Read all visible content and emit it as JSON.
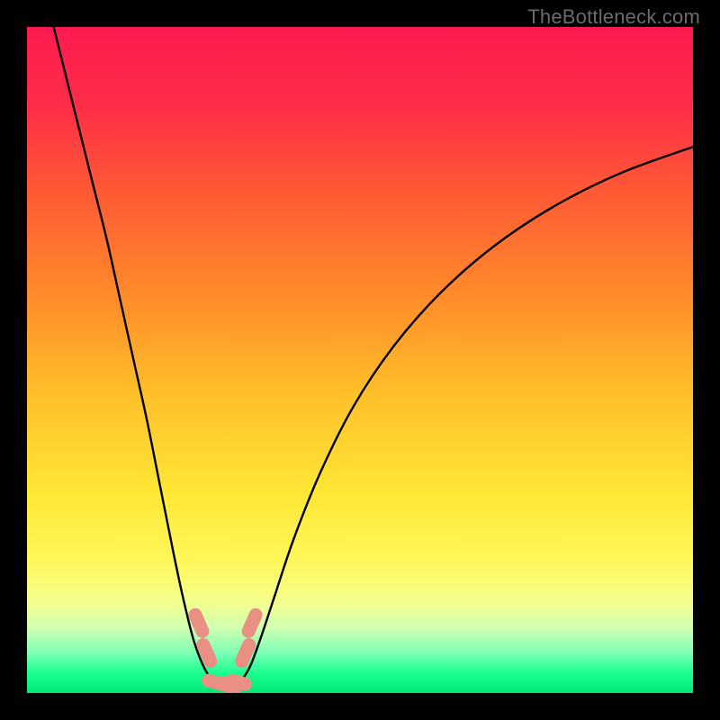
{
  "watermark": "TheBottleneck.com",
  "chart_data": {
    "type": "line",
    "title": "",
    "xlabel": "",
    "ylabel": "",
    "xlim": [
      0,
      100
    ],
    "ylim": [
      0,
      100
    ],
    "grid": false,
    "legend": false,
    "background_gradient": {
      "stops": [
        {
          "pct": 0,
          "color": "#ff1a51"
        },
        {
          "pct": 12,
          "color": "#ff2e47"
        },
        {
          "pct": 25,
          "color": "#ff5a35"
        },
        {
          "pct": 40,
          "color": "#ff8a2a"
        },
        {
          "pct": 55,
          "color": "#ffbf2a"
        },
        {
          "pct": 70,
          "color": "#ffe735"
        },
        {
          "pct": 80,
          "color": "#fff75a"
        },
        {
          "pct": 86,
          "color": "#f6ff8a"
        },
        {
          "pct": 90,
          "color": "#d4ffb0"
        },
        {
          "pct": 94,
          "color": "#7dffb5"
        },
        {
          "pct": 97,
          "color": "#1aff8f"
        },
        {
          "pct": 100,
          "color": "#00e874"
        }
      ]
    },
    "series": [
      {
        "name": "left-branch",
        "color": "#000000",
        "x": [
          4,
          6,
          8,
          10,
          12,
          14,
          16,
          18,
          20,
          22,
          23.5,
          25,
          26.5,
          28
        ],
        "y": [
          100,
          92,
          84,
          76,
          68,
          59,
          50,
          41,
          31,
          21,
          14,
          8,
          4,
          1.5
        ]
      },
      {
        "name": "right-branch",
        "color": "#000000",
        "x": [
          32,
          33.5,
          35,
          37,
          40,
          44,
          49,
          55,
          62,
          70,
          79,
          89,
          100
        ],
        "y": [
          1.5,
          4,
          8,
          14,
          23,
          33,
          43,
          52,
          60,
          67,
          73,
          78,
          82
        ]
      },
      {
        "name": "valley-floor",
        "color": "#000000",
        "x": [
          28,
          29,
          30,
          31,
          32
        ],
        "y": [
          1.5,
          1.2,
          1.1,
          1.2,
          1.5
        ]
      }
    ],
    "markers": [
      {
        "name": "left-marker-upper",
        "x": 25.8,
        "y": 10.5,
        "color": "#e98f84"
      },
      {
        "name": "left-marker-lower",
        "x": 27.0,
        "y": 6.0,
        "color": "#e98f84"
      },
      {
        "name": "right-marker-upper",
        "x": 33.8,
        "y": 10.5,
        "color": "#e98f84"
      },
      {
        "name": "right-marker-lower",
        "x": 32.8,
        "y": 6.0,
        "color": "#e98f84"
      },
      {
        "name": "floor-marker-a",
        "x": 28.2,
        "y": 1.6,
        "color": "#e98f84"
      },
      {
        "name": "floor-marker-b",
        "x": 29.4,
        "y": 1.3,
        "color": "#e98f84"
      },
      {
        "name": "floor-marker-c",
        "x": 30.6,
        "y": 1.3,
        "color": "#e98f84"
      },
      {
        "name": "floor-marker-d",
        "x": 31.8,
        "y": 1.6,
        "color": "#e98f84"
      }
    ]
  }
}
